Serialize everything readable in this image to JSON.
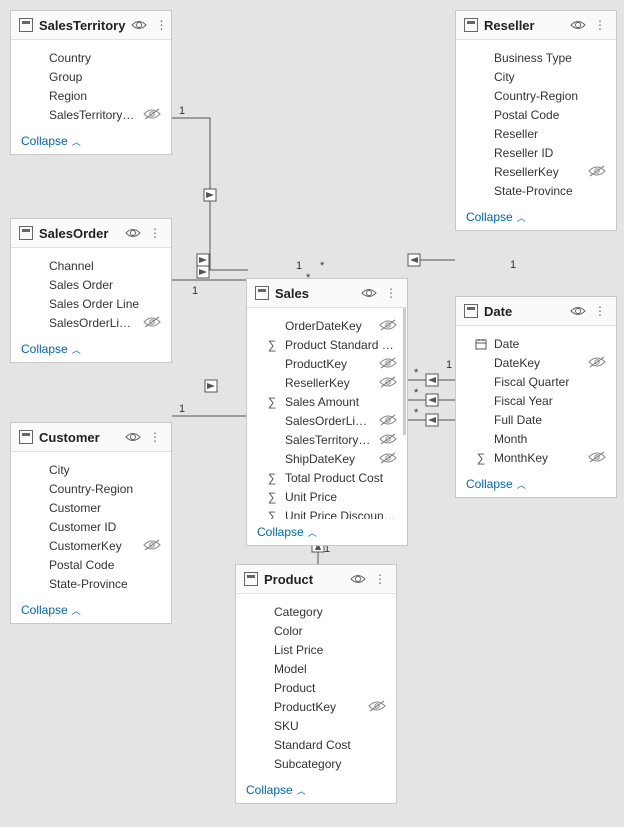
{
  "tables": {
    "salesTerritory": {
      "title": "SalesTerritory",
      "collapse": "Collapse",
      "fields": [
        {
          "label": "Country",
          "icon": "",
          "hidden": false
        },
        {
          "label": "Group",
          "icon": "",
          "hidden": false
        },
        {
          "label": "Region",
          "icon": "",
          "hidden": false
        },
        {
          "label": "SalesTerritoryKey",
          "icon": "",
          "hidden": true
        }
      ]
    },
    "reseller": {
      "title": "Reseller",
      "collapse": "Collapse",
      "fields": [
        {
          "label": "Business Type",
          "icon": "",
          "hidden": false
        },
        {
          "label": "City",
          "icon": "",
          "hidden": false
        },
        {
          "label": "Country-Region",
          "icon": "",
          "hidden": false
        },
        {
          "label": "Postal Code",
          "icon": "",
          "hidden": false
        },
        {
          "label": "Reseller",
          "icon": "",
          "hidden": false
        },
        {
          "label": "Reseller ID",
          "icon": "",
          "hidden": false
        },
        {
          "label": "ResellerKey",
          "icon": "",
          "hidden": true
        },
        {
          "label": "State-Province",
          "icon": "",
          "hidden": false
        }
      ]
    },
    "salesOrder": {
      "title": "SalesOrder",
      "collapse": "Collapse",
      "fields": [
        {
          "label": "Channel",
          "icon": "",
          "hidden": false
        },
        {
          "label": "Sales Order",
          "icon": "",
          "hidden": false
        },
        {
          "label": "Sales Order Line",
          "icon": "",
          "hidden": false
        },
        {
          "label": "SalesOrderLineKey",
          "icon": "",
          "hidden": true
        }
      ]
    },
    "sales": {
      "title": "Sales",
      "collapse": "Collapse",
      "fields": [
        {
          "label": "OrderDateKey",
          "icon": "",
          "hidden": true
        },
        {
          "label": "Product Standard Cost",
          "icon": "sum",
          "hidden": false
        },
        {
          "label": "ProductKey",
          "icon": "",
          "hidden": true
        },
        {
          "label": "ResellerKey",
          "icon": "",
          "hidden": true
        },
        {
          "label": "Sales Amount",
          "icon": "sum",
          "hidden": false
        },
        {
          "label": "SalesOrderLineKey",
          "icon": "",
          "hidden": true
        },
        {
          "label": "SalesTerritoryKey",
          "icon": "",
          "hidden": true
        },
        {
          "label": "ShipDateKey",
          "icon": "",
          "hidden": true
        },
        {
          "label": "Total Product Cost",
          "icon": "sum",
          "hidden": false
        },
        {
          "label": "Unit Price",
          "icon": "sum",
          "hidden": false
        },
        {
          "label": "Unit Price Discount Pct",
          "icon": "sum",
          "hidden": false
        }
      ]
    },
    "date": {
      "title": "Date",
      "collapse": "Collapse",
      "fields": [
        {
          "label": "Date",
          "icon": "calendar",
          "hidden": false
        },
        {
          "label": "DateKey",
          "icon": "",
          "hidden": true
        },
        {
          "label": "Fiscal Quarter",
          "icon": "",
          "hidden": false
        },
        {
          "label": "Fiscal Year",
          "icon": "",
          "hidden": false
        },
        {
          "label": "Full Date",
          "icon": "",
          "hidden": false
        },
        {
          "label": "Month",
          "icon": "",
          "hidden": false
        },
        {
          "label": "MonthKey",
          "icon": "sum",
          "hidden": true
        }
      ]
    },
    "customer": {
      "title": "Customer",
      "collapse": "Collapse",
      "fields": [
        {
          "label": "City",
          "icon": "",
          "hidden": false
        },
        {
          "label": "Country-Region",
          "icon": "",
          "hidden": false
        },
        {
          "label": "Customer",
          "icon": "",
          "hidden": false
        },
        {
          "label": "Customer ID",
          "icon": "",
          "hidden": false
        },
        {
          "label": "CustomerKey",
          "icon": "",
          "hidden": true
        },
        {
          "label": "Postal Code",
          "icon": "",
          "hidden": false
        },
        {
          "label": "State-Province",
          "icon": "",
          "hidden": false
        }
      ]
    },
    "product": {
      "title": "Product",
      "collapse": "Collapse",
      "fields": [
        {
          "label": "Category",
          "icon": "",
          "hidden": false
        },
        {
          "label": "Color",
          "icon": "",
          "hidden": false
        },
        {
          "label": "List Price",
          "icon": "",
          "hidden": false
        },
        {
          "label": "Model",
          "icon": "",
          "hidden": false
        },
        {
          "label": "Product",
          "icon": "",
          "hidden": false
        },
        {
          "label": "ProductKey",
          "icon": "",
          "hidden": true
        },
        {
          "label": "SKU",
          "icon": "",
          "hidden": false
        },
        {
          "label": "Standard Cost",
          "icon": "",
          "hidden": false
        },
        {
          "label": "Subcategory",
          "icon": "",
          "hidden": false
        }
      ]
    }
  },
  "cardinality": {
    "one": "1",
    "many": "*"
  }
}
